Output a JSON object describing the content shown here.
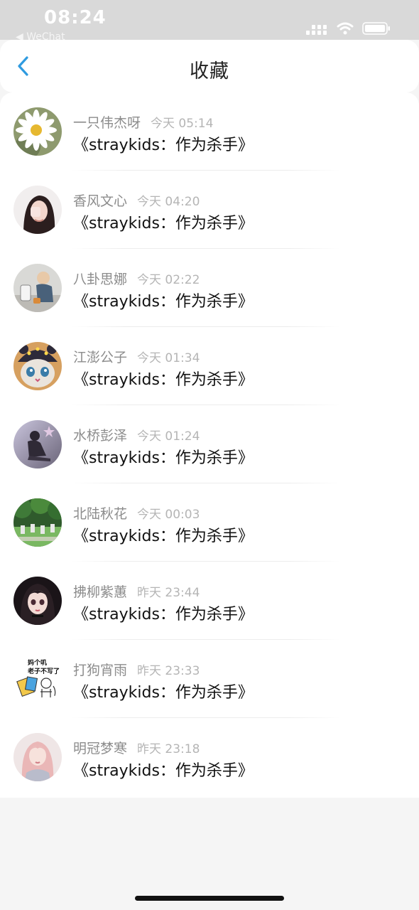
{
  "status_bar": {
    "time": "08:24",
    "back_app": "◀ WeChat"
  },
  "header": {
    "title": "收藏",
    "back_icon": "chevron-left-icon"
  },
  "items": [
    {
      "name": "一只伟杰呀",
      "time": "今天 05:14",
      "text": "《straykids：作为杀手》",
      "avatar": "daisy"
    },
    {
      "name": "香风文心",
      "time": "今天 04:20",
      "text": "《straykids：作为杀手》",
      "avatar": "girl-dark-hair"
    },
    {
      "name": "八卦思娜",
      "time": "今天 02:22",
      "text": "《straykids：作为杀手》",
      "avatar": "child"
    },
    {
      "name": "江澎公子",
      "time": "今天 01:34",
      "text": "《straykids：作为杀手》",
      "avatar": "cat-hat"
    },
    {
      "name": "水桥彭泽",
      "time": "今天 01:24",
      "text": "《straykids：作为杀手》",
      "avatar": "sitting-figure"
    },
    {
      "name": "北陆秋花",
      "time": "今天 00:03",
      "text": "《straykids：作为杀手》",
      "avatar": "garden"
    },
    {
      "name": "拂柳紫蕙",
      "time": "昨天 23:44",
      "text": "《straykids：作为杀手》",
      "avatar": "anime-girl"
    },
    {
      "name": "打狗宵雨",
      "time": "昨天 23:33",
      "text": "《straykids：作为杀手》",
      "avatar": "meme-sticker"
    },
    {
      "name": "明冠梦寒",
      "time": "昨天 23:18",
      "text": "《straykids：作为杀手》",
      "avatar": "pink-hair-girl"
    }
  ],
  "avatar_captions": {
    "meme_line1": "妈个叽",
    "meme_line2": "老子不写了"
  },
  "colors": {
    "accent": "#2f9be0",
    "status_bar_bg": "#d9d9d9",
    "page_bg": "#f5f5f5"
  }
}
